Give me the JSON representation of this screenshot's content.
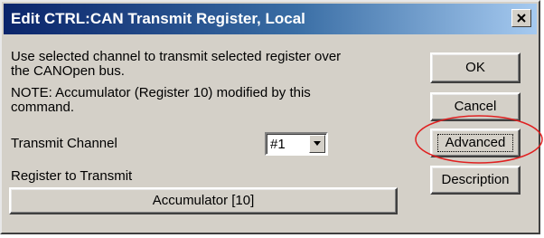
{
  "window": {
    "title": "Edit CTRL:CAN Transmit Register, Local"
  },
  "description": {
    "line1": "Use selected channel to transmit selected register over",
    "line2": "the CANOpen bus.",
    "line3": "NOTE:  Accumulator (Register 10) modified by this",
    "line4": "command."
  },
  "transmit_channel": {
    "label": "Transmit Channel",
    "selected": "#1"
  },
  "register": {
    "label": "Register to Transmit",
    "button_label": "Accumulator [10]"
  },
  "buttons": {
    "ok": "OK",
    "cancel": "Cancel",
    "advanced": "Advanced",
    "description": "Description"
  },
  "icons": {
    "close": "close-icon",
    "dropdown": "chevron-down-icon"
  },
  "highlight": {
    "color": "#e02020",
    "target": "Advanced"
  }
}
